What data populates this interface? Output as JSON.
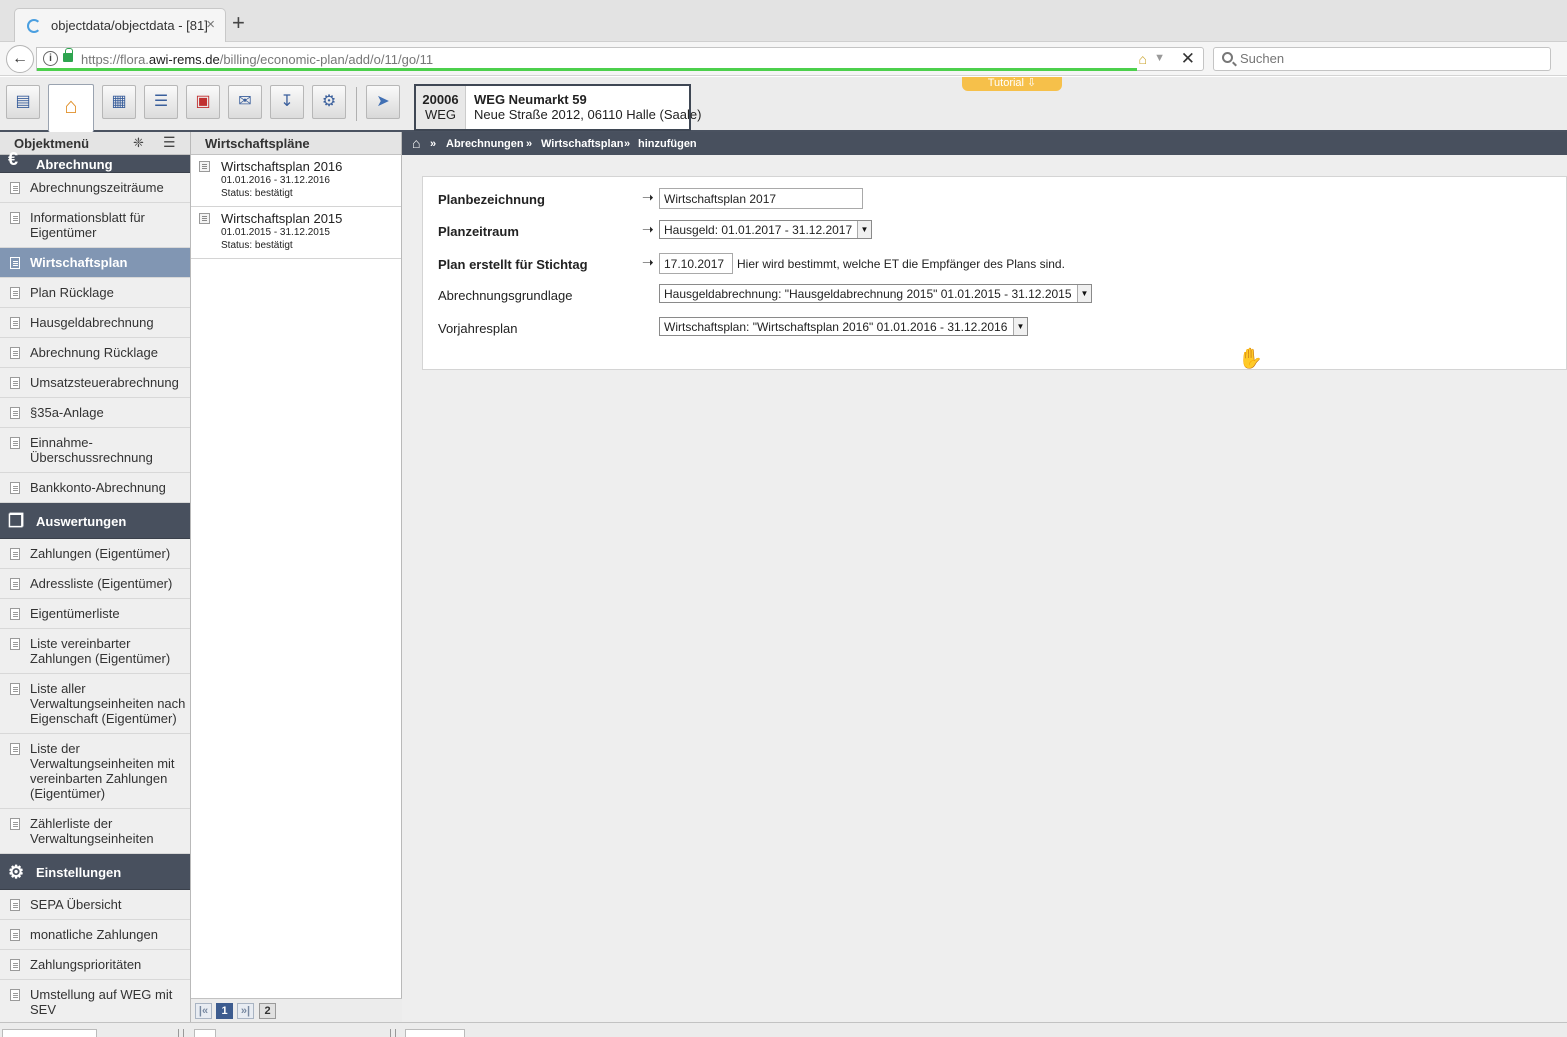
{
  "browser": {
    "tab_title": "objectdata/objectdata - [81]",
    "tab_close": "×",
    "new_tab": "+",
    "url_host_prefix": "https://flora.",
    "url_host": "awi-rems.de",
    "url_path": "/billing/economic-plan/add/o/11/go/11",
    "search_placeholder": "Suchen"
  },
  "object": {
    "number": "20006",
    "type": "WEG",
    "name": "WEG Neumarkt 59",
    "address": "Neue Straße 2012, 06110 Halle (Saale)"
  },
  "tutorial_label": "Tutorial ⇩",
  "toolbar_icons": [
    "contact-card-icon",
    "home-icon",
    "calendar-icon",
    "list-icon",
    "pdf-icon",
    "mail-icon",
    "download-icon",
    "settings-icon",
    "rocket-icon"
  ],
  "left_menu": {
    "header": "Objektmenü",
    "section_billing": "Abrechnung",
    "billing_items": [
      "Abrechnungszeiträume",
      "Informationsblatt für Eigentümer",
      "Wirtschaftsplan",
      "Plan Rücklage",
      "Hausgeldabrechnung",
      "Abrechnung Rücklage",
      "Umsatzsteuerabrechnung",
      "§35a-Anlage",
      "Einnahme-Überschussrechnung",
      "Bankkonto-Abrechnung"
    ],
    "section_reports": "Auswertungen",
    "report_items": [
      "Zahlungen (Eigentümer)",
      "Adressliste (Eigentümer)",
      "Eigentümerliste",
      "Liste vereinbarter Zahlungen (Eigentümer)",
      "Liste aller Verwaltungseinheiten nach Eigenschaft (Eigentümer)",
      "Liste der Verwaltungseinheiten mit vereinbarten Zahlungen (Eigentümer)",
      "Zählerliste der Verwaltungseinheiten"
    ],
    "section_settings": "Einstellungen",
    "settings_items": [
      "SEPA Übersicht",
      "monatliche Zahlungen",
      "Zahlungsprioritäten",
      "Umstellung auf WEG mit SEV"
    ]
  },
  "plans_panel": {
    "header": "Wirtschaftspläne",
    "items": [
      {
        "title": "Wirtschaftsplan 2016",
        "period": "01.01.2016 - 31.12.2016",
        "status": "Status: bestätigt"
      },
      {
        "title": "Wirtschaftsplan 2015",
        "period": "01.01.2015 - 31.12.2015",
        "status": "Status: bestätigt"
      }
    ],
    "pager": {
      "first": "|«",
      "current": "1",
      "next": "»|",
      "total": "2"
    }
  },
  "breadcrumb": [
    "Abrechnungen",
    "Wirtschaftsplan",
    "hinzufügen"
  ],
  "breadcrumb_sep": "»",
  "form": {
    "plan_name_label": "Planbezeichnung",
    "plan_name_value": "Wirtschaftsplan 2017",
    "plan_period_label": "Planzeitraum",
    "plan_period_value": "Hausgeld: 01.01.2017 - 31.12.2017",
    "reference_date_label": "Plan erstellt für Stichtag",
    "reference_date_value": "17.10.2017",
    "reference_date_hint": "Hier wird bestimmt, welche ET die Empfänger des Plans sind.",
    "billing_basis_label": "Abrechnungsgrundlage",
    "billing_basis_value": "Hausgeldabrechnung: \"Hausgeldabrechnung 2015\" 01.01.2015 - 31.12.2015",
    "previous_plan_label": "Vorjahresplan",
    "previous_plan_value": "Wirtschaftsplan: \"Wirtschaftsplan 2016\" 01.01.2016 - 31.12.2016",
    "arrow": "➝"
  }
}
